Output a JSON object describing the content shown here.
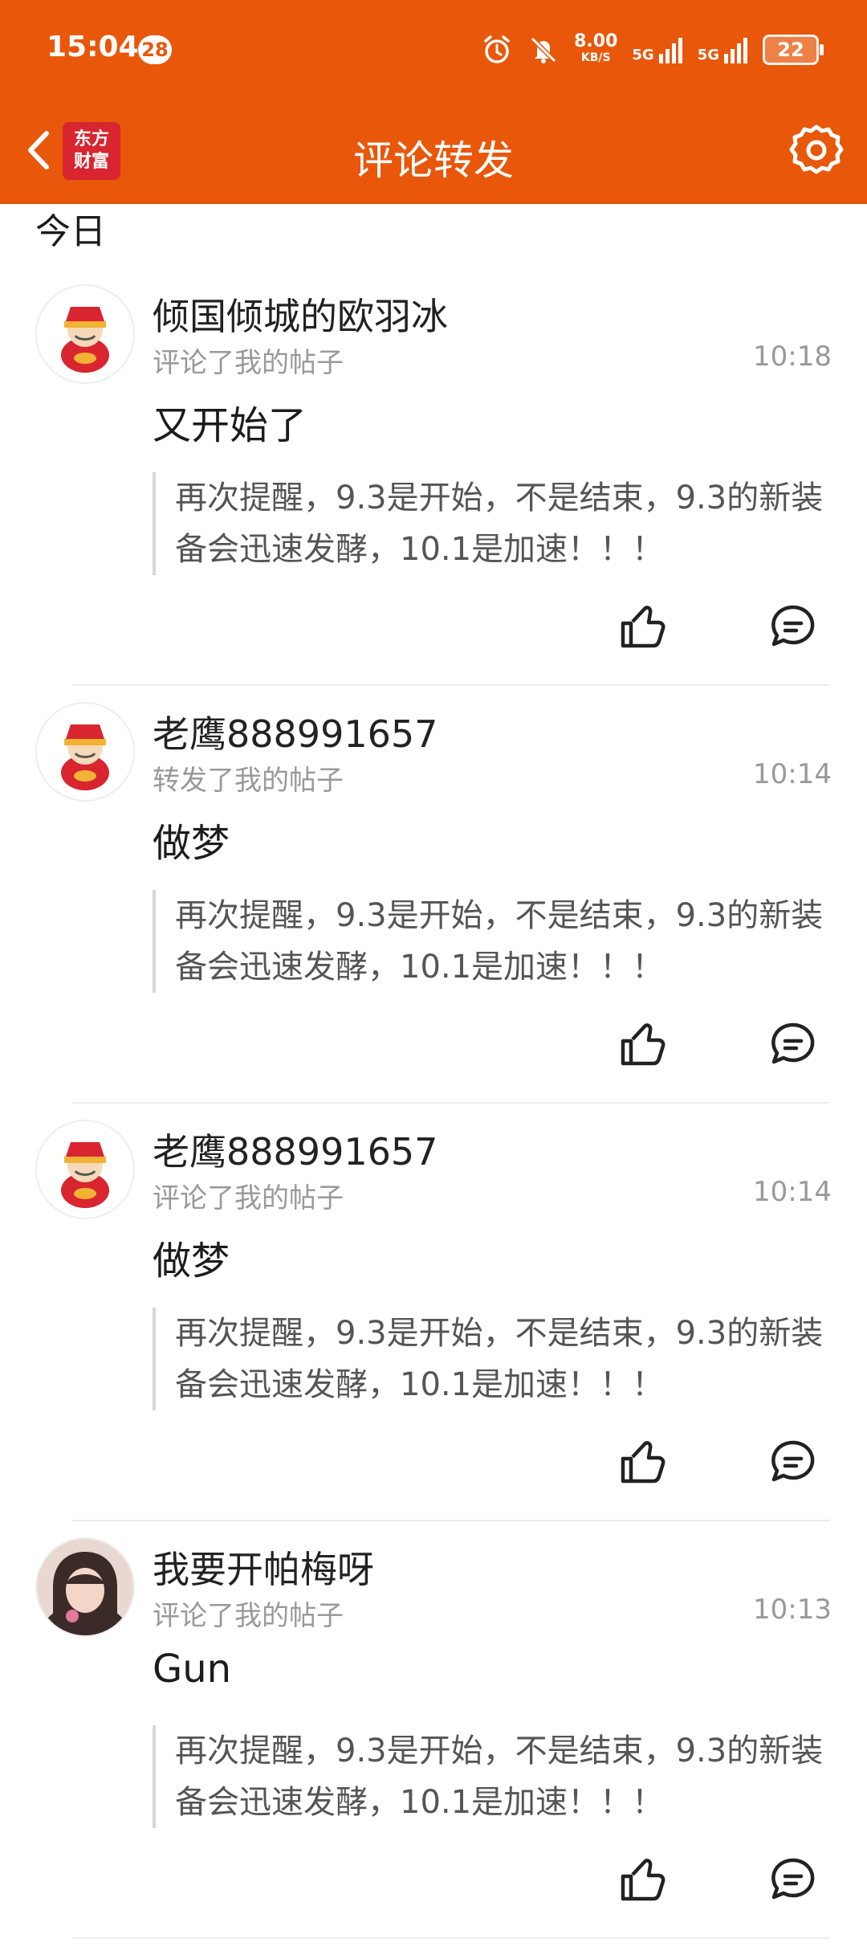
{
  "status_bar": {
    "time": "15:04",
    "notification_count": "28",
    "net_speed": "8.00",
    "net_unit": "KB/S",
    "signal_1": "5G",
    "signal_2": "5G",
    "battery": "22"
  },
  "header": {
    "logo_line1": "东方",
    "logo_line2": "财富",
    "title": "评论转发"
  },
  "section_label": "今日",
  "items": [
    {
      "name": "倾国倾城的欧羽冰",
      "action": "评论了我的帖子",
      "time": "10:18",
      "comment": "又开始了",
      "quote": "再次提醒，9.3是开始，不是结束，9.3的新装备会迅速发酵，10.1是加速！！！"
    },
    {
      "name": "老鹰888991657",
      "action": "转发了我的帖子",
      "time": "10:14",
      "comment": "做梦",
      "quote": "再次提醒，9.3是开始，不是结束，9.3的新装备会迅速发酵，10.1是加速！！！"
    },
    {
      "name": "老鹰888991657",
      "action": "评论了我的帖子",
      "time": "10:14",
      "comment": "做梦",
      "quote": "再次提醒，9.3是开始，不是结束，9.3的新装备会迅速发酵，10.1是加速！！！"
    },
    {
      "name": "我要开帕梅呀",
      "action": "评论了我的帖子",
      "time": "10:13",
      "comment": "Gun",
      "quote": "再次提醒，9.3是开始，不是结束，9.3的新装备会迅速发酵，10.1是加速！！！"
    }
  ],
  "colors": {
    "brand": "#e8570a",
    "logo": "#d8252f"
  }
}
